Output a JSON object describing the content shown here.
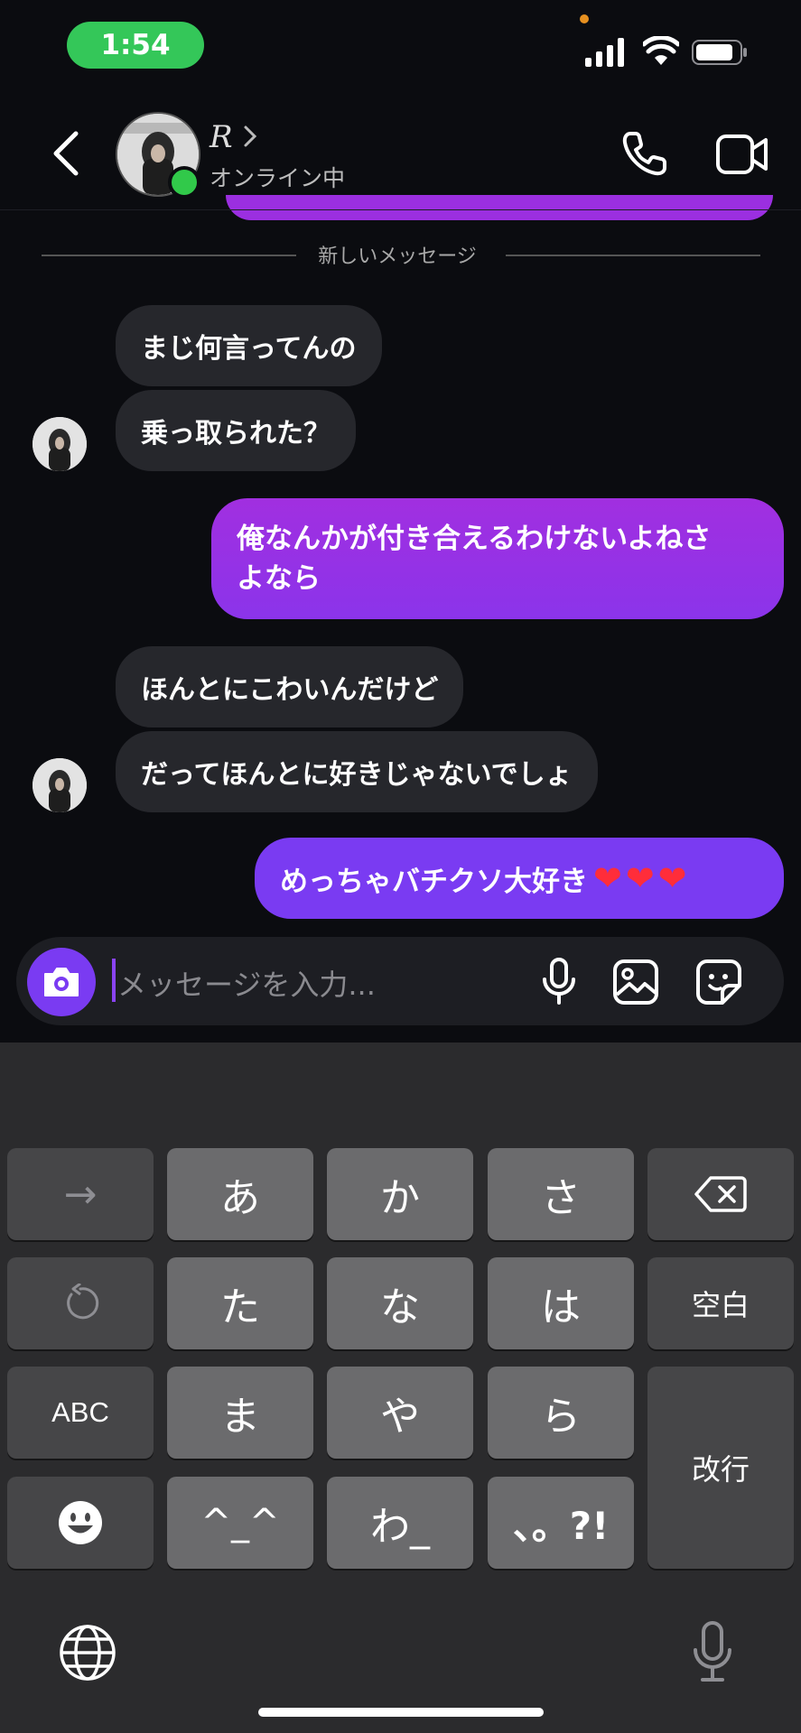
{
  "status_bar": {
    "time": "1:54"
  },
  "header": {
    "name": "R",
    "status": "オンライン中"
  },
  "divider": {
    "label": "新しいメッセージ"
  },
  "messages": [
    {
      "from": "them",
      "text": "まじ何言ってんの"
    },
    {
      "from": "them",
      "text": "乗っ取られた？"
    },
    {
      "from": "me",
      "text": "俺なんかが付き合えるわけないよねさよなら",
      "line1": "俺なんかが付き合えるわけないよねさ",
      "line2": "よなら"
    },
    {
      "from": "them",
      "text": "ほんとにこわいんだけど"
    },
    {
      "from": "them",
      "text": "だってほんとに好きじゃないでしょ"
    },
    {
      "from": "me",
      "text": "めっちゃバチクソ大好き❤️❤️❤️",
      "words": "めっちゃバチクソ大好き",
      "hearts": "❤❤❤"
    }
  ],
  "composer": {
    "placeholder": "メッセージを入力..."
  },
  "keyboard": {
    "row1": [
      "→",
      "あ",
      "か",
      "さ",
      "⌫"
    ],
    "row2": [
      "↺",
      "た",
      "な",
      "は",
      "空白"
    ],
    "row3": [
      "ABC",
      "ま",
      "や",
      "ら"
    ],
    "row4": [
      "☺",
      "^_^",
      "わ_",
      "、。?!"
    ],
    "enter": "改行"
  },
  "colors": {
    "accent": "#7a3bf2",
    "outgoing_top": "#a12fe0",
    "outgoing_bottom": "#7a3bf2",
    "incoming": "#26272c",
    "online": "#31c94a"
  }
}
